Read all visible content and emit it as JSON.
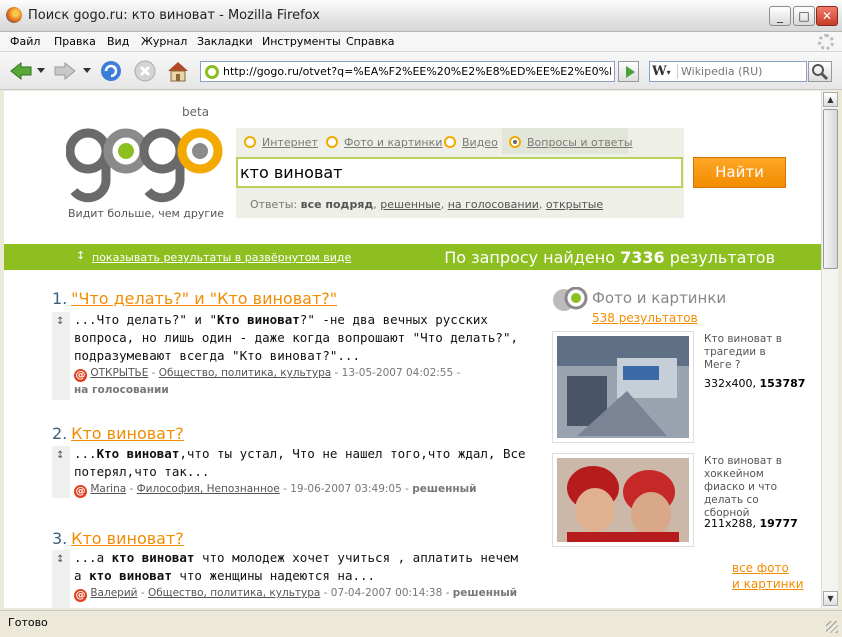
{
  "window": {
    "title": "Поиск gogo.ru: кто виноват - Mozilla Firefox",
    "min": "_",
    "max": "□",
    "close": "✕"
  },
  "menu": [
    "Файл",
    "Правка",
    "Вид",
    "Журнал",
    "Закладки",
    "Инструменты",
    "Справка"
  ],
  "toolbar": {
    "url": "http://gogo.ru/otvet?q=%EA%F2%EE%20%E2%E8%ED%EE%E2%E0%F",
    "search_engine": "W",
    "search_placeholder": "Wikipedia (RU)"
  },
  "logo": {
    "beta": "beta",
    "tagline": "Видит больше, чем другие"
  },
  "tabs": [
    {
      "label": "Интернет",
      "selected": false
    },
    {
      "label": "Фото и картинки",
      "selected": false
    },
    {
      "label": "Видео",
      "selected": false
    },
    {
      "label": "Вопросы и ответы",
      "selected": true
    }
  ],
  "search": {
    "query": "кто виноват",
    "button": "Найти",
    "filters_label": "Ответы:",
    "filters": [
      "все подряд",
      "решенные",
      "на голосовании",
      "открытые"
    ]
  },
  "bar": {
    "expand_link": "показывать результаты в развёрнутом виде",
    "count_prefix": "По запросу найдено",
    "count": "7336",
    "count_suffix": "результатов"
  },
  "results": [
    {
      "num": "1.",
      "title": "\"Что делать?\" и \"Кто виноват?\"",
      "lines": [
        [
          "...Что делать?\" и \"",
          "Кто виноват",
          "?\" -не два вечных русских"
        ],
        [
          "вопроса, но лишь один - даже когда вопрошают \"Что делать?\","
        ],
        [
          "подразумевают всегда \"Кто виноват?\"..."
        ]
      ],
      "author": "ОТКРЫТЬЕ",
      "category": "Общество, политика, культура",
      "date": "13-05-2007 04:02:55",
      "status": "на голосовании"
    },
    {
      "num": "2.",
      "title": "Кто виноват?",
      "lines": [
        [
          "...",
          "Кто виноват",
          ",что ты устал, Что не нашел того,что ждал, Все"
        ],
        [
          "потерял,что так..."
        ]
      ],
      "author": "Marina",
      "category": "Философия, Непознанное",
      "date": "19-06-2007 03:49:05",
      "status": "решенный"
    },
    {
      "num": "3.",
      "title": "Кто виноват?",
      "lines": [
        [
          "...а ",
          "кто виноват",
          " что молодеж хочет учиться , аплатить нечем"
        ],
        [
          "а ",
          "кто виноват",
          " что женщины надеются на..."
        ]
      ],
      "author": "Валерий",
      "category": "Общество, политика, культура",
      "date": "07-04-2007 00:14:38",
      "status": "решенный"
    }
  ],
  "sidebar": {
    "title": "Фото и картинки",
    "count_link": "538 результатов",
    "images": [
      {
        "caption": "Кто виноват в трагедии в Меге ?",
        "size": "332x400,",
        "id": "153787"
      },
      {
        "caption": "Кто виноват в хоккейном фиаско и что делать со сборной",
        "size": "211x288,",
        "id": "19777"
      }
    ],
    "all_link_1": "все фото",
    "all_link_2": "и картинки"
  },
  "status": "Готово",
  "colors": {
    "accent": "#f28c00",
    "green": "#8cbf1f"
  }
}
